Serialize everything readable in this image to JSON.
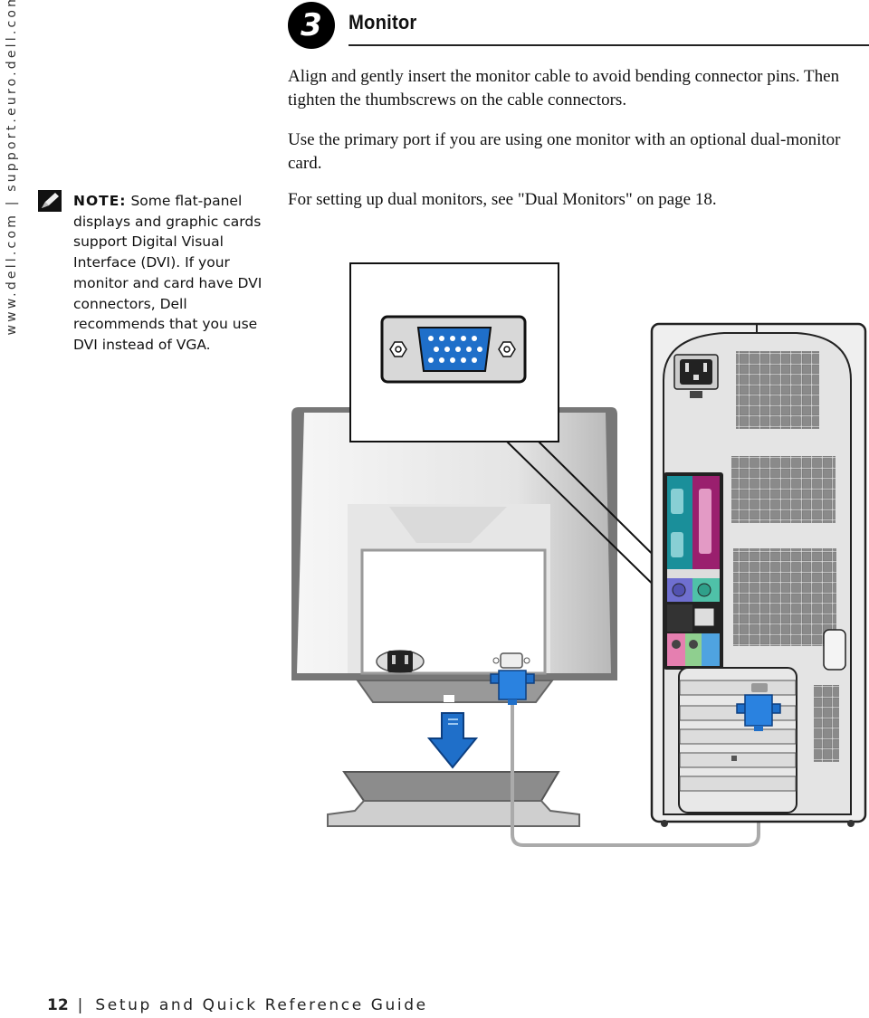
{
  "sidebar": {
    "url_text": "www.dell.com | support.euro.dell.com"
  },
  "step": {
    "number": "3",
    "title": "Monitor"
  },
  "instructions": {
    "paragraphs": [
      "Align and gently insert the monitor cable to avoid bending connector pins. Then tighten the thumbscrews on the cable connectors.",
      "Use the primary port if you are using one monitor with an optional dual-monitor card.",
      "For setting up dual monitors, see \"Dual Monitors\" on page 18."
    ]
  },
  "note": {
    "icon": "pencil-note-icon",
    "label": "NOTE:",
    "text": "Some flat-panel displays and graphic cards support Digital Visual Interface (DVI). If your monitor and card have DVI connectors, Dell recommends that you use DVI instead of VGA."
  },
  "illustration": {
    "callout": "vga-port-closeup",
    "items": [
      "monitor-back",
      "monitor-stand",
      "down-arrow",
      "computer-tower-back",
      "vga-cable"
    ],
    "colors": {
      "vga_blue": "#1f6fc9",
      "serial_teal": "#1a8f9a",
      "parallel_magenta": "#9a1f6e",
      "ps2_purple": "#6f6fd0",
      "ps2_green": "#4fc1a8",
      "audio_pink": "#e57fb0",
      "audio_green": "#8fcf8f",
      "audio_blue": "#4fa3e0"
    }
  },
  "footer": {
    "page_number": "12",
    "separator": "|",
    "guide_title": "Setup and Quick Reference Guide"
  }
}
